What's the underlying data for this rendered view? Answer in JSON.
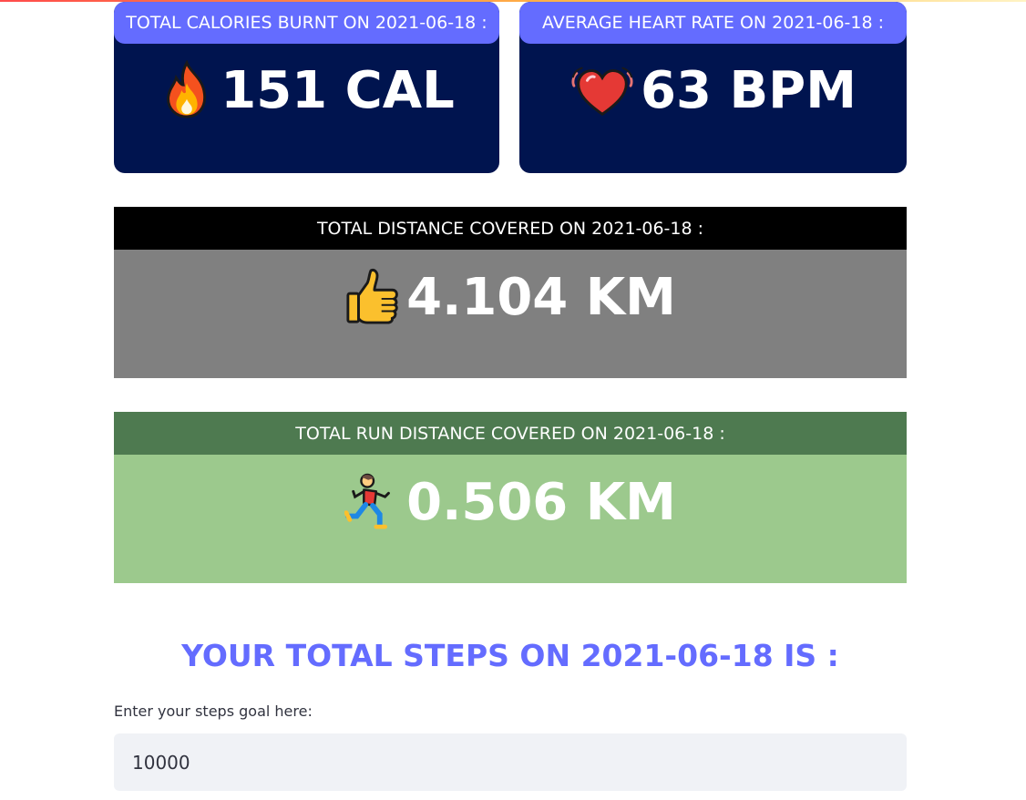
{
  "calories": {
    "header": "TOTAL CALORIES BURNT ON 2021-06-18 :",
    "value": "151 CAL",
    "icon": "fire-icon",
    "bg_color": "#00144f",
    "header_color": "#646cff"
  },
  "heart_rate": {
    "header": "AVERAGE HEART RATE ON 2021-06-18 :",
    "value": "63 BPM",
    "icon": "beating-heart-icon",
    "bg_color": "#00144f",
    "header_color": "#646cff"
  },
  "distance": {
    "header": "TOTAL DISTANCE COVERED ON 2021-06-18 :",
    "value": "4.104 KM",
    "icon": "thumbs-up-icon",
    "header_color": "#000000",
    "bg_color": "#808080"
  },
  "run_distance": {
    "header": "TOTAL RUN DISTANCE COVERED ON 2021-06-18 :",
    "value": "0.506 KM",
    "icon": "running-person-icon",
    "header_color": "#4e7a50",
    "bg_color": "#9cc98d"
  },
  "steps": {
    "title": "YOUR TOTAL STEPS ON 2021-06-18 IS :",
    "goal_label": "Enter your steps goal here:",
    "goal_value": "10000",
    "title_color": "#646cff"
  }
}
